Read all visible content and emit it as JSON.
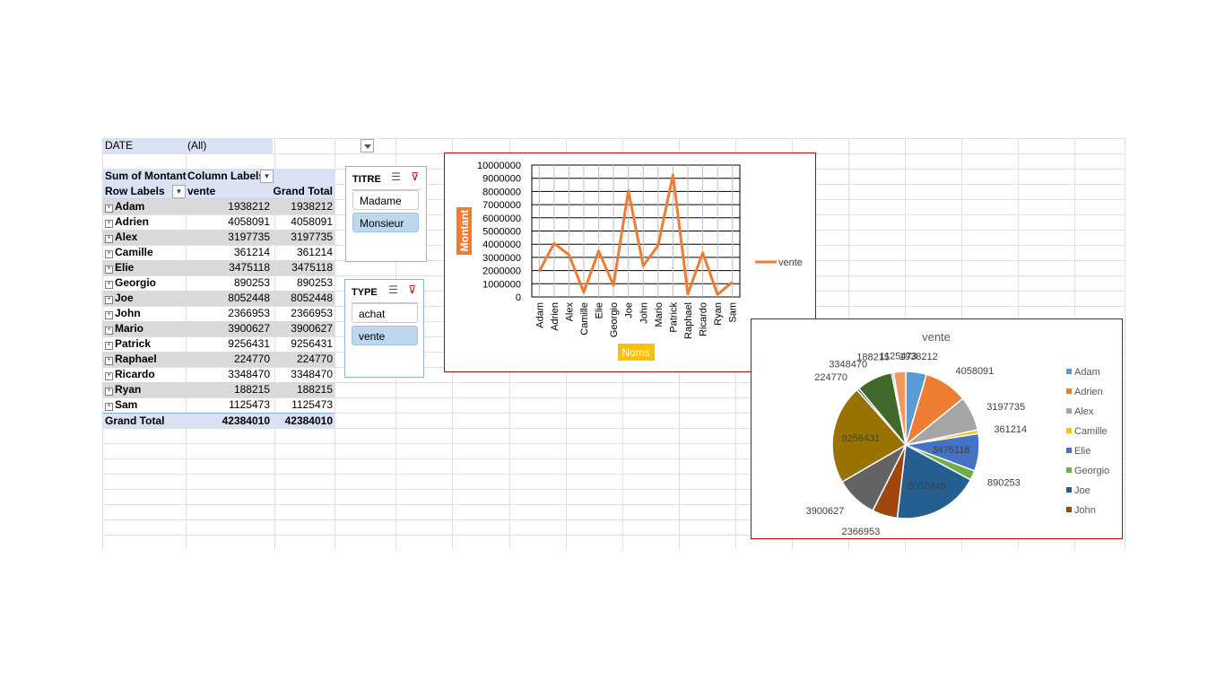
{
  "pivot": {
    "filter": {
      "label": "DATE",
      "value": "(All)"
    },
    "header": {
      "sum_label": "Sum of Montant",
      "col_labels": "Column Labels",
      "row_labels": "Row Labels",
      "vente": "vente",
      "grand_total": "Grand Total"
    },
    "rows": [
      {
        "name": "Adam",
        "vente": "1938212",
        "total": "1938212"
      },
      {
        "name": "Adrien",
        "vente": "4058091",
        "total": "4058091"
      },
      {
        "name": "Alex",
        "vente": "3197735",
        "total": "3197735"
      },
      {
        "name": "Camille",
        "vente": "361214",
        "total": "361214"
      },
      {
        "name": "Elie",
        "vente": "3475118",
        "total": "3475118"
      },
      {
        "name": "Georgio",
        "vente": "890253",
        "total": "890253"
      },
      {
        "name": "Joe",
        "vente": "8052448",
        "total": "8052448"
      },
      {
        "name": "John",
        "vente": "2366953",
        "total": "2366953"
      },
      {
        "name": "Mario",
        "vente": "3900627",
        "total": "3900627"
      },
      {
        "name": "Patrick",
        "vente": "9256431",
        "total": "9256431"
      },
      {
        "name": "Raphael",
        "vente": "224770",
        "total": "224770"
      },
      {
        "name": "Ricardo",
        "vente": "3348470",
        "total": "3348470"
      },
      {
        "name": "Ryan",
        "vente": "188215",
        "total": "188215"
      },
      {
        "name": "Sam",
        "vente": "1125473",
        "total": "1125473"
      }
    ],
    "grand_total": {
      "label": "Grand Total",
      "vente": "42384010",
      "total": "42384010"
    }
  },
  "slicers": {
    "titre": {
      "title": "TITRE",
      "items": [
        {
          "label": "Madame",
          "selected": false
        },
        {
          "label": "Monsieur",
          "selected": true
        }
      ]
    },
    "type": {
      "title": "TYPE",
      "items": [
        {
          "label": "achat",
          "selected": false
        },
        {
          "label": "vente",
          "selected": true
        }
      ]
    }
  },
  "chart_data": [
    {
      "type": "line",
      "title": "",
      "xlabel": "Noms",
      "ylabel": "Montant",
      "categories": [
        "Adam",
        "Adrien",
        "Alex",
        "Camille",
        "Elie",
        "Georgio",
        "Joe",
        "John",
        "Mario",
        "Patrick",
        "Raphael",
        "Ricardo",
        "Ryan",
        "Sam"
      ],
      "series": [
        {
          "name": "vente",
          "values": [
            1938212,
            4058091,
            3197735,
            361214,
            3475118,
            890253,
            8052448,
            2366953,
            3900627,
            9256431,
            224770,
            3348470,
            188215,
            1125473
          ],
          "color": "#ed7d31"
        }
      ],
      "ylim": [
        0,
        10000000
      ],
      "yticks": [
        "0",
        "1000000",
        "2000000",
        "3000000",
        "4000000",
        "5000000",
        "6000000",
        "7000000",
        "8000000",
        "9000000",
        "10000000"
      ],
      "grid": true,
      "legend": "right",
      "legend_label": "vente"
    },
    {
      "type": "pie",
      "title": "vente",
      "categories": [
        "Adam",
        "Adrien",
        "Alex",
        "Camille",
        "Elie",
        "Georgio",
        "Joe",
        "John",
        "Mario",
        "Patrick",
        "Raphael",
        "Ricardo",
        "Ryan",
        "Sam"
      ],
      "values": [
        1938212,
        4058091,
        3197735,
        361214,
        3475118,
        890253,
        8052448,
        2366953,
        3900627,
        9256431,
        224770,
        3348470,
        188215,
        1125473
      ],
      "data_labels": [
        "1938212",
        "4058091",
        "3197735",
        "361214",
        "3475118",
        "890253",
        "8052448",
        "2366953",
        "3900627",
        "9256431",
        "224770",
        "3348470",
        "188215",
        "1125473"
      ],
      "colors": [
        "#5b9bd5",
        "#ed7d31",
        "#a5a5a5",
        "#ffc000",
        "#4472c4",
        "#70ad47",
        "#255e91",
        "#9e480e",
        "#636363",
        "#997300",
        "#264478",
        "#43682b",
        "#7cafdd",
        "#f1975a"
      ],
      "legend": "right",
      "legend_items": [
        "Adam",
        "Adrien",
        "Alex",
        "Camille",
        "Elie",
        "Georgio",
        "Joe",
        "John"
      ]
    }
  ],
  "colors": {
    "pivot_header": "#d9e1f2",
    "band": "#d9d9d9",
    "slicer_selected": "#bdd7ee",
    "chart_border": "#c00000",
    "line": "#ed7d31",
    "axis_title_bg": "#ed7d31",
    "xaxis_title_bg": "#ffc000"
  }
}
